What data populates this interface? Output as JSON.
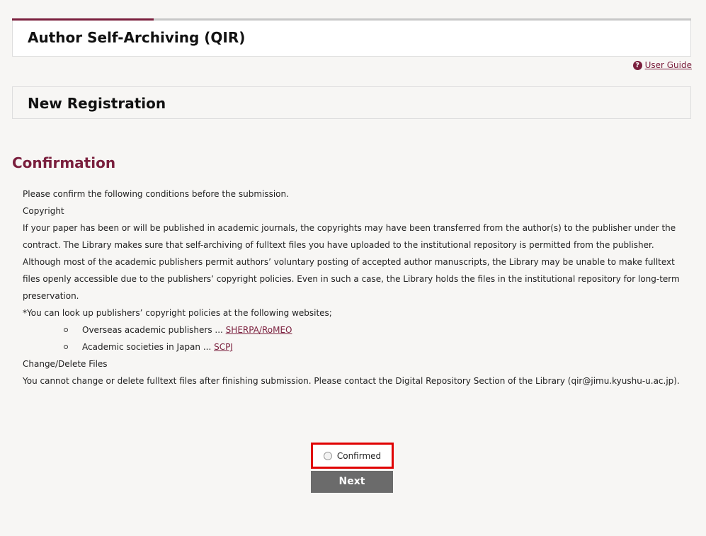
{
  "header": {
    "title": "Author Self-Archiving (QIR)"
  },
  "user_guide": {
    "icon": "help-icon",
    "label": "User Guide"
  },
  "registration": {
    "title": "New Registration"
  },
  "confirmation": {
    "title": "Confirmation",
    "intro": "Please confirm the following conditions before the submission.",
    "copyright_heading": "Copyright",
    "copyright_text": "If your paper has been or will be published in academic journals, the copyrights may have been transferred from the author(s) to the publisher under the contract. The Library makes sure that self-archiving of fulltext files you have uploaded to the institutional repository is permitted from the publisher. Although most of the academic publishers permit authors’ voluntary posting of accepted author manuscripts, the Library may be unable to make fulltext files openly accessible due to the publishers’ copyright policies. Even in such a case, the Library holds the files in the institutional repository for long-term preservation.",
    "lookup_note": "*You can look up publishers’ copyright policies at the following websites;",
    "sites": [
      {
        "label": "Overseas academic publishers ... ",
        "link": "SHERPA/RoMEO"
      },
      {
        "label": "Academic societies in Japan ... ",
        "link": "SCPJ"
      }
    ],
    "change_heading": "Change/Delete Files",
    "change_text": "You cannot change or delete fulltext files after finishing submission. Please contact the Digital Repository Section of the Library (qir@jimu.kyushu-u.ac.jp)."
  },
  "confirm_option": {
    "label": "Confirmed"
  },
  "next_button": {
    "label": "Next"
  },
  "colors": {
    "accent": "#7a1f3d",
    "highlight": "#e00000",
    "button": "#6b6b6b"
  }
}
